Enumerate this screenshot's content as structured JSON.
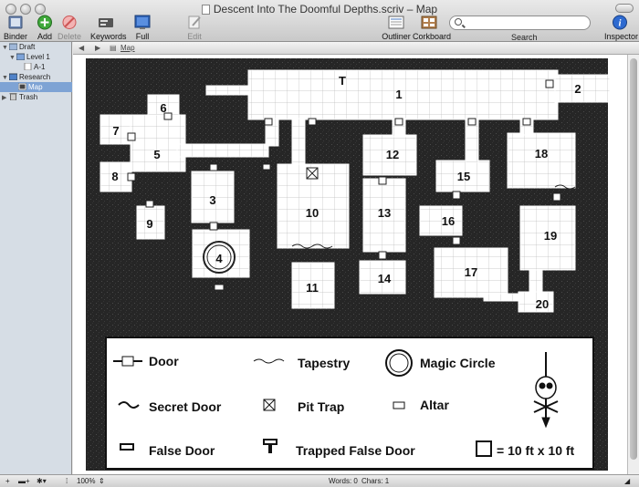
{
  "window": {
    "title": "Descent Into The Doomful Depths.scriv – Map"
  },
  "toolbar": {
    "binder": "Binder",
    "add": "Add",
    "delete": "Delete",
    "keywords": "Keywords",
    "fullscreen": "Full Screen",
    "edit_scrivenings": "Edit Scrivenings",
    "outliner": "Outliner",
    "corkboard": "Corkboard",
    "search_label": "Search",
    "inspector": "Inspector"
  },
  "search": {
    "placeholder": ""
  },
  "binder": {
    "items": [
      {
        "label": "Draft"
      },
      {
        "label": "Level 1"
      },
      {
        "label": "A-1"
      },
      {
        "label": "Research"
      },
      {
        "label": "Map"
      },
      {
        "label": "Trash"
      }
    ]
  },
  "editor": {
    "header_title": "Map",
    "zoom": "100%",
    "words": "Words: 0",
    "chars": "Chars: 1"
  },
  "map": {
    "rooms": [
      "1",
      "2",
      "3",
      "4",
      "5",
      "6",
      "7",
      "8",
      "9",
      "10",
      "11",
      "12",
      "13",
      "14",
      "15",
      "16",
      "17",
      "18",
      "19",
      "20"
    ],
    "marker_t": "T",
    "legend": {
      "door": "Door",
      "tapestry": "Tapestry",
      "magic_circle": "Magic Circle",
      "secret_door": "Secret Door",
      "pit_trap": "Pit Trap",
      "altar": "Altar",
      "false_door": "False Door",
      "trapped_false_door": "Trapped False Door",
      "scale": "= 10 ft x 10 ft"
    }
  },
  "colors": {
    "rock": "#262626",
    "floor": "#ffffff",
    "grid": "#bfbfbf",
    "selection": "#7ea3d4",
    "sidebar": "#d6dde5"
  }
}
